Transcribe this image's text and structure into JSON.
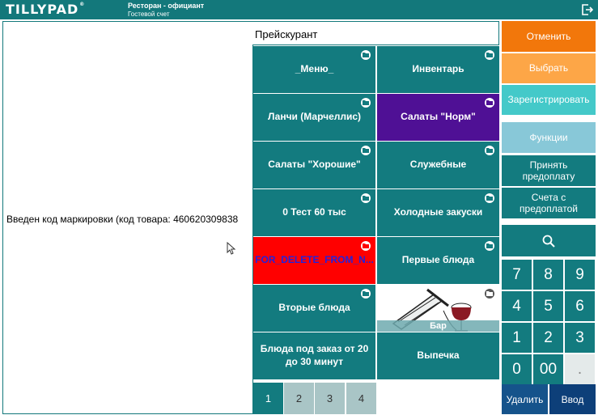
{
  "header": {
    "logo": "TILLYPAD",
    "logo_mark": "®",
    "title": "Ресторан - официант",
    "subtitle": "Гостевой счет"
  },
  "left_panel": {
    "message": "Введен код маркировки (код товара: 460620309838"
  },
  "price_list": {
    "title": "Прейскурант",
    "tiles": [
      {
        "label": "_Меню_"
      },
      {
        "label": "Инвентарь"
      },
      {
        "label": "Ланчи (Марчеллис)"
      },
      {
        "label": "Салаты \"Норм\""
      },
      {
        "label": "Салаты \"Хорошие\""
      },
      {
        "label": "Служебные"
      },
      {
        "label": "0 Тест 60 тыс"
      },
      {
        "label": "Холодные закуски"
      },
      {
        "label": "FOR_DELETE_FROM_N..."
      },
      {
        "label": "Первые блюда"
      },
      {
        "label": "Вторые блюда"
      },
      {
        "label": "Бар"
      },
      {
        "label": "Блюда под заказ от 20 до 30 минут"
      },
      {
        "label": "Выпечка"
      }
    ],
    "pages": [
      "1",
      "2",
      "3",
      "4"
    ],
    "active_page": "1"
  },
  "actions": {
    "cancel": "Отменить",
    "select": "Выбрать",
    "register": "Зарегистрировать",
    "functions": "Функции",
    "accept_prepay": "Принять предоплату",
    "prepay_bills": "Счета с предоплатой",
    "delete": "Удалить",
    "enter": "Ввод"
  },
  "numpad": {
    "keys": [
      "7",
      "8",
      "9",
      "4",
      "5",
      "6",
      "1",
      "2",
      "3",
      "0",
      "00",
      "."
    ]
  },
  "colors": {
    "brand_teal": "#13787b",
    "cancel_orange": "#f2770b",
    "select_orange": "#fda647",
    "register_cyan": "#44c9c9",
    "functions_blue": "#88c8d8",
    "delete_blue": "#15538b",
    "enter_navy": "#0d3f79",
    "tile_red": "#ff0000",
    "tile_purple": "#4f1095"
  }
}
